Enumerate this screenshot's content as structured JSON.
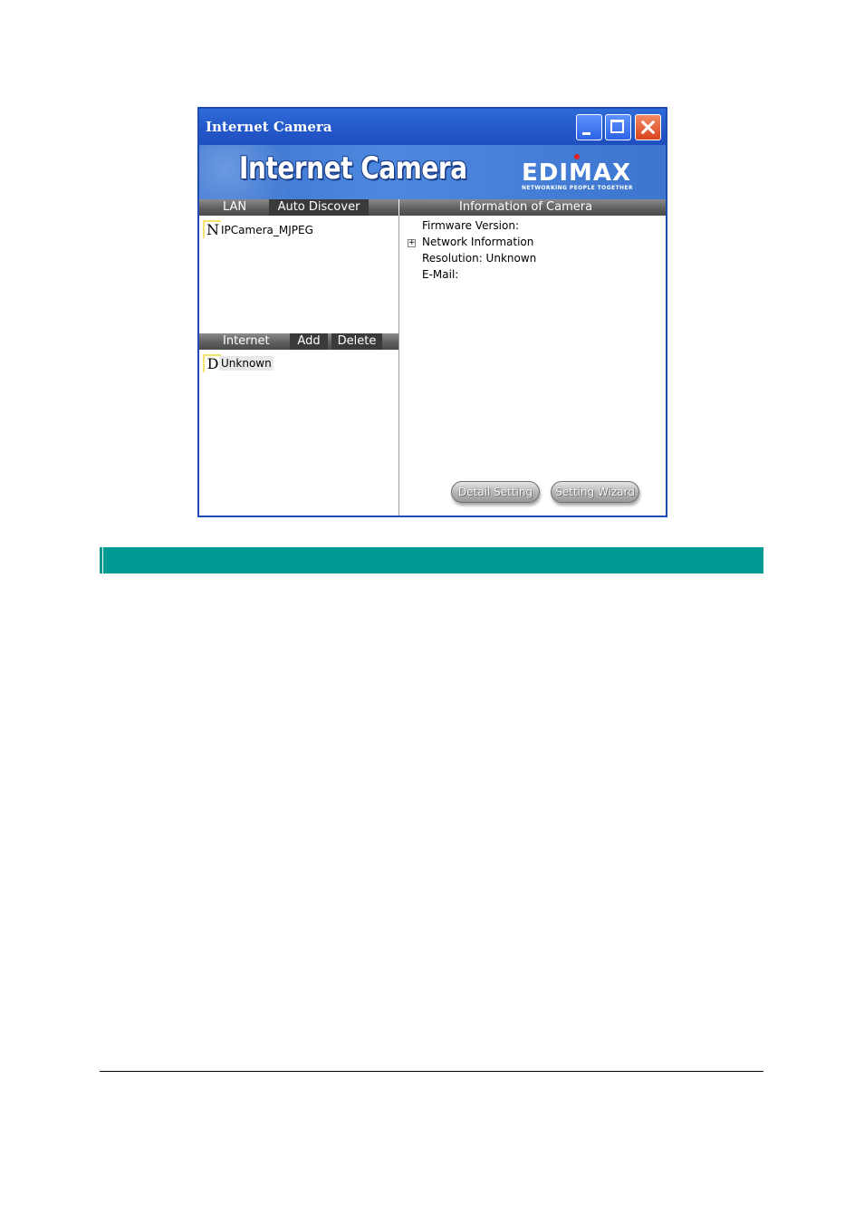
{
  "window": {
    "title": "Internet Camera",
    "controls": {
      "minimize": "minimize-icon",
      "maximize": "maximize-icon",
      "close": "close-icon"
    }
  },
  "banner": {
    "title": "Internet Camera",
    "logo": "EDIMAX",
    "logo_tagline": "NETWORKING PEOPLE TOGETHER"
  },
  "lan_panel": {
    "header": {
      "label": "LAN",
      "button": "Auto Discover"
    },
    "items": [
      {
        "letter": "N",
        "name": "IPCamera_MJPEG"
      }
    ]
  },
  "internet_panel": {
    "header": {
      "label": "Internet",
      "add": "Add",
      "delete": "Delete"
    },
    "items": [
      {
        "letter": "D",
        "name": "Unknown"
      }
    ]
  },
  "info_panel": {
    "header": "Information of Camera",
    "lines": {
      "firmware": "Firmware Version:",
      "network": "Network Information",
      "expand": "+",
      "resolution": "Resolution: Unknown",
      "email": "E-Mail:"
    },
    "buttons": {
      "detail": "Detail Setting",
      "wizard": "Setting Wizard"
    }
  },
  "colors": {
    "title_bar": "#2357c9",
    "section_band": "#009a93",
    "close_button": "#d8431c"
  }
}
